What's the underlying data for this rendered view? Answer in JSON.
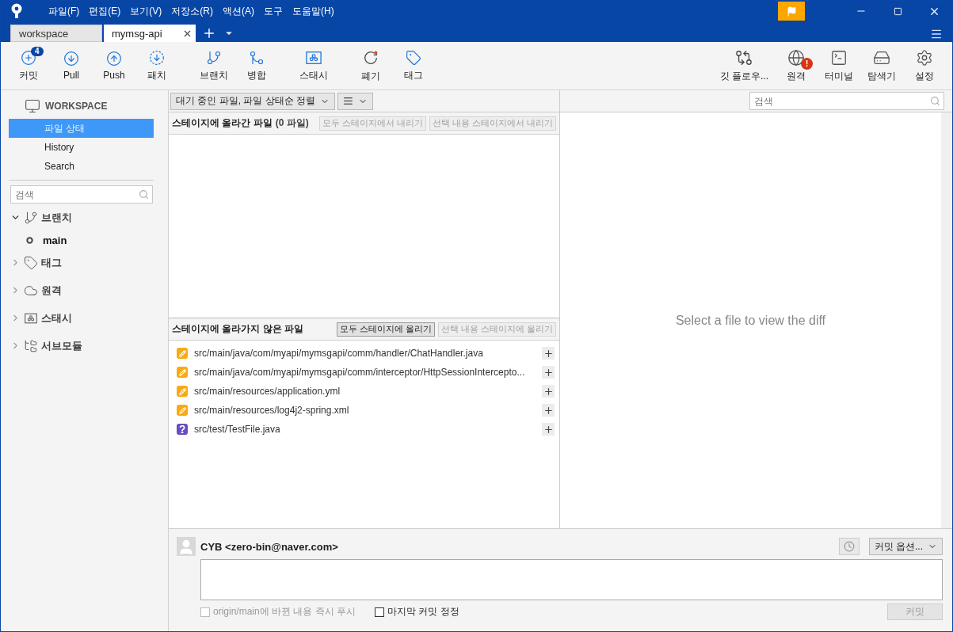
{
  "menu": [
    "파일(F)",
    "편집(E)",
    "보기(V)",
    "저장소(R)",
    "액션(A)",
    "도구",
    "도움말(H)"
  ],
  "tabs": [
    {
      "label": "workspace",
      "selected": false
    },
    {
      "label": "mymsg-api",
      "selected": true
    }
  ],
  "toolbar": {
    "left": [
      {
        "kind": "commit",
        "label": "커밋",
        "badge": {
          "text": "4",
          "kind": "count"
        }
      },
      {
        "kind": "pull",
        "label": "Pull"
      },
      {
        "kind": "push",
        "label": "Push"
      },
      {
        "kind": "fetch",
        "label": "패치"
      },
      {
        "kind": "branch",
        "label": "브랜치"
      },
      {
        "kind": "merge",
        "label": "병합"
      },
      {
        "kind": "stash",
        "label": "스태시"
      },
      {
        "kind": "discard",
        "label": "폐기"
      },
      {
        "kind": "tag",
        "label": "태그"
      }
    ],
    "right": [
      {
        "kind": "gitflow",
        "label": "깃 플로우..."
      },
      {
        "kind": "remote",
        "label": "원격",
        "badge": {
          "text": "!",
          "kind": "alert"
        }
      },
      {
        "kind": "terminal",
        "label": "터미널"
      },
      {
        "kind": "explorer",
        "label": "탐색기"
      },
      {
        "kind": "settings",
        "label": "설정"
      }
    ]
  },
  "sidebar": {
    "workspace": "WORKSPACE",
    "items": [
      {
        "label": "파일 상태",
        "selected": true
      },
      {
        "label": "History",
        "selected": false
      },
      {
        "label": "Search",
        "selected": false
      }
    ],
    "search": {
      "placeholder": "검색"
    },
    "sections": [
      {
        "kind": "branch",
        "label": "브랜치",
        "expanded": true,
        "children": [
          {
            "label": "main",
            "current": true
          }
        ]
      },
      {
        "kind": "tag",
        "label": "태그",
        "expanded": false
      },
      {
        "kind": "remote",
        "label": "원격",
        "expanded": false
      },
      {
        "kind": "stash",
        "label": "스태시",
        "expanded": false
      },
      {
        "kind": "submodule",
        "label": "서브모듈",
        "expanded": false
      }
    ]
  },
  "file_toolbar": {
    "sort": "대기 중인 파일, 파일 상태순 정렬",
    "search": {
      "placeholder": "검색"
    }
  },
  "staged": {
    "title": "스테이지에 올라간 파일",
    "count": "(0 파일)",
    "buttons": [
      {
        "label": "모두 스테이지에서 내리기",
        "disabled": true
      },
      {
        "label": "선택 내용 스테이지에서 내리기",
        "disabled": true
      }
    ]
  },
  "unstaged": {
    "title": "스테이지에 올라가지 않은 파일",
    "buttons": [
      {
        "label": "모두 스테이지에 올리기",
        "disabled": false
      },
      {
        "label": "선택 내용 스테이지에 올리기",
        "disabled": true
      }
    ],
    "files": [
      {
        "kind": "modified",
        "path": "src/main/java/com/myapi/mymsgapi/comm/handler/ChatHandler.java"
      },
      {
        "kind": "modified",
        "path": "src/main/java/com/myapi/mymsgapi/comm/interceptor/HttpSessionIntercepto..."
      },
      {
        "kind": "modified",
        "path": "src/main/resources/application.yml"
      },
      {
        "kind": "modified",
        "path": "src/main/resources/log4j2-spring.xml"
      },
      {
        "kind": "untracked",
        "path": "src/test/TestFile.java"
      }
    ]
  },
  "diff": {
    "message": "Select a file to view the diff"
  },
  "commit": {
    "author": "CYB <zero-bin@naver.com>",
    "options": "커밋 옵션...",
    "push_option": {
      "label": "origin/main에 바뀐 내용 즉시 푸시",
      "checked": false,
      "disabled": true
    },
    "amend": {
      "label": "마지막 커밋 정정",
      "checked": false,
      "disabled": false
    },
    "button": {
      "label": "커밋",
      "disabled": true
    }
  }
}
